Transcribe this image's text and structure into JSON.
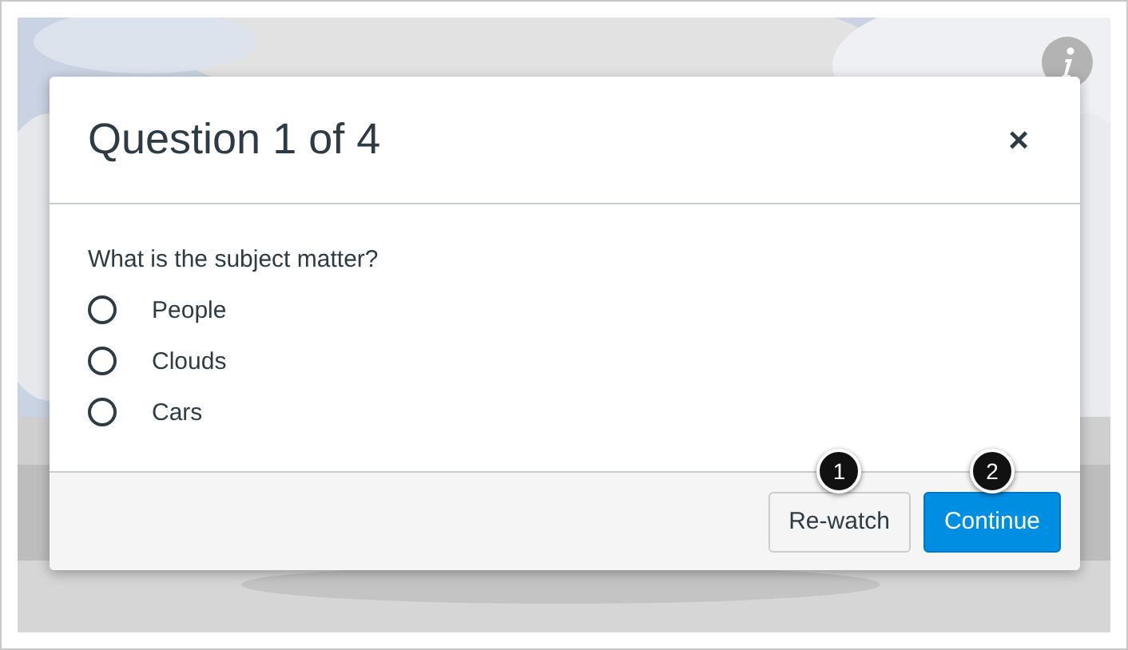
{
  "dialog": {
    "title": "Question 1 of 4",
    "close": "×"
  },
  "question": "What is the subject matter?",
  "options": [
    {
      "label": "People",
      "selected": false
    },
    {
      "label": "Clouds",
      "selected": false
    },
    {
      "label": "Cars",
      "selected": false
    }
  ],
  "buttons": [
    {
      "label": "Re-watch",
      "kind": "secondary",
      "callout": "1"
    },
    {
      "label": "Continue",
      "kind": "primary",
      "callout": "2"
    }
  ]
}
